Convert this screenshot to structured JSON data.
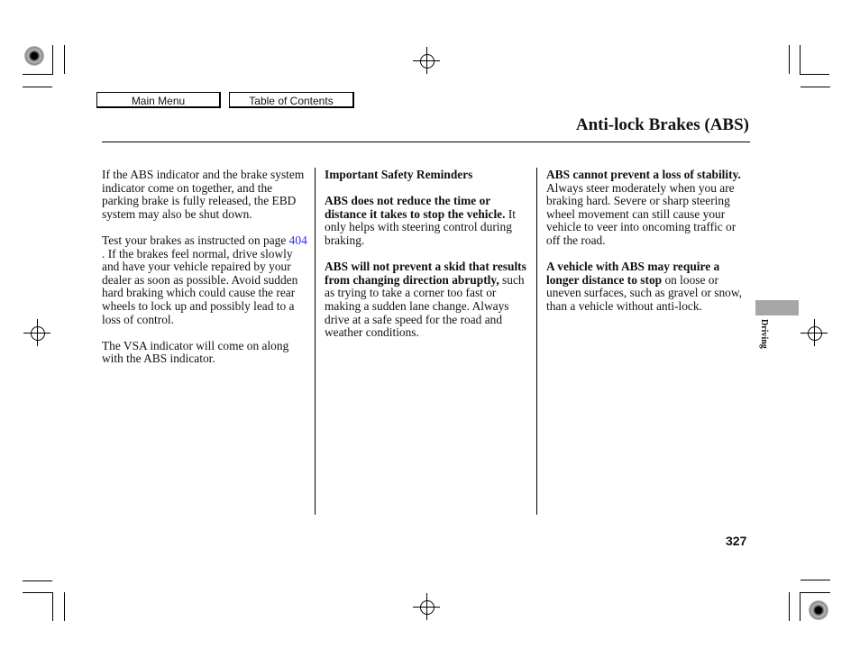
{
  "nav": {
    "main_menu": "Main Menu",
    "table_of_contents": "Table of Contents"
  },
  "header": {
    "title": "Anti-lock Brakes (ABS)"
  },
  "columns": {
    "col1": {
      "p1": "If the ABS indicator and the brake system indicator come on together, and the parking brake is fully released, the EBD system may also be shut down.",
      "p2_before": "Test your brakes as instructed on page ",
      "p2_link": "404",
      "p2_after": " . If the brakes feel normal, drive slowly and have your vehicle repaired by your dealer as soon as possible. Avoid sudden hard braking which could cause the rear wheels to lock up and possibly lead to a loss of control.",
      "p3": "The VSA indicator will come on along with the ABS indicator."
    },
    "col2": {
      "heading": "Important Safety Reminders",
      "p1_bold": "ABS does not reduce the time or distance it takes to stop the vehicle.",
      "p1_text": " It only helps with steering control during braking.",
      "p2_bold": "ABS will not prevent a skid that results from changing direction abruptly,",
      "p2_text": " such as trying to take a corner too fast or making a sudden lane change. Always drive at a safe speed for the road and weather conditions."
    },
    "col3": {
      "p1_bold": "ABS cannot prevent a loss of stability.",
      "p1_text": " Always steer moderately when you are braking hard. Severe or sharp steering wheel movement can still cause your vehicle to veer into oncoming traffic or off the road.",
      "p2_bold": "A vehicle with ABS may require a longer distance to stop",
      "p2_text": " on loose or uneven surfaces, such as gravel or snow, than a vehicle without anti-lock."
    }
  },
  "side_tab": {
    "label": "Driving"
  },
  "footer": {
    "page_number": "327"
  }
}
